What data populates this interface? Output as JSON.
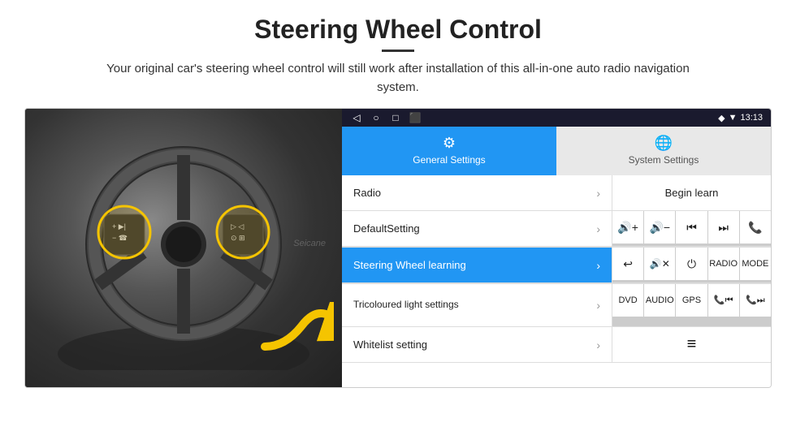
{
  "header": {
    "title": "Steering Wheel Control",
    "subtitle": "Your original car's steering wheel control will still work after installation of this all-in-one auto radio navigation system.",
    "divider_color": "#333"
  },
  "status_bar": {
    "nav_icons": [
      "◁",
      "○",
      "□",
      "⬛"
    ],
    "signal_icon": "◆",
    "wifi_icon": "▼",
    "time": "13:13"
  },
  "tabs": [
    {
      "id": "general",
      "label": "General Settings",
      "icon": "⚙",
      "active": true
    },
    {
      "id": "system",
      "label": "System Settings",
      "icon": "🌐",
      "active": false
    }
  ],
  "menu_items": [
    {
      "id": "radio",
      "label": "Radio",
      "highlighted": false
    },
    {
      "id": "default",
      "label": "DefaultSetting",
      "highlighted": false
    },
    {
      "id": "steering",
      "label": "Steering Wheel learning",
      "highlighted": true
    },
    {
      "id": "tricolour",
      "label": "Tricoloured light settings",
      "highlighted": false
    },
    {
      "id": "whitelist",
      "label": "Whitelist setting",
      "highlighted": false
    }
  ],
  "begin_learn": "Begin learn",
  "control_buttons": [
    [
      "🔊+",
      "🔊−",
      "⏮",
      "⏭",
      "📞"
    ],
    [
      "↩",
      "🔊✕",
      "⏻",
      "RADIO",
      "MODE"
    ],
    [
      "DVD",
      "AUDIO",
      "GPS",
      "📞⏮",
      "📞⏭"
    ]
  ],
  "bottom_icon": "≡",
  "colors": {
    "active_tab_bg": "#2196f3",
    "highlighted_menu_bg": "#2196f3",
    "status_bar_bg": "#1a1a2e"
  }
}
